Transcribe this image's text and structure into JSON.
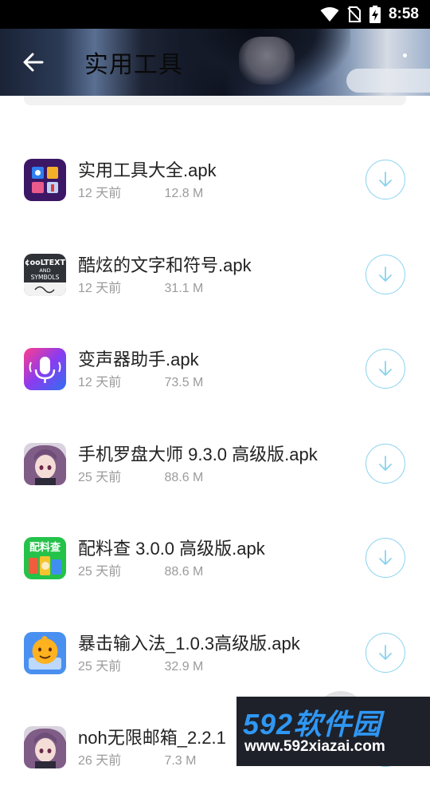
{
  "status_bar": {
    "time": "8:58"
  },
  "header": {
    "title": "实用工具"
  },
  "files": [
    {
      "name": "实用工具大全.apk",
      "age": "12 天前",
      "size": "12.8 M",
      "icon": "toolbox-app-icon"
    },
    {
      "name": "酷炫的文字和符号.apk",
      "age": "12 天前",
      "size": "31.1 M",
      "icon": "cool-text-symbols-app-icon",
      "icon_text": [
        "¢ooLTEXT",
        "AND",
        "SYMBOLS"
      ]
    },
    {
      "name": "变声器助手.apk",
      "age": "12 天前",
      "size": "73.5 M",
      "icon": "voice-changer-microphone-icon"
    },
    {
      "name": "手机罗盘大师 9.3.0 高级版.apk",
      "age": "25 天前",
      "size": "88.6 M",
      "icon": "anime-avatar-icon"
    },
    {
      "name": "配料查 3.0.0 高级版.apk",
      "age": "25 天前",
      "size": "88.6 M",
      "icon": "ingredient-check-app-icon",
      "icon_text": "配料查"
    },
    {
      "name": "暴击输入法_1.0.3高级版.apk",
      "age": "25 天前",
      "size": "32.9 M",
      "icon": "mascot-keyboard-app-icon"
    },
    {
      "name": "noh无限邮箱_2.2.1",
      "age": "26 天前",
      "size": "7.3 M",
      "icon": "anime-avatar-icon"
    }
  ],
  "watermark": {
    "brand": "592软件园",
    "url": "www.592xiazai.com"
  },
  "colors": {
    "accent": "#8ad3ef",
    "watermark_blue": "#2f97f4",
    "status_bar": "#000000"
  }
}
